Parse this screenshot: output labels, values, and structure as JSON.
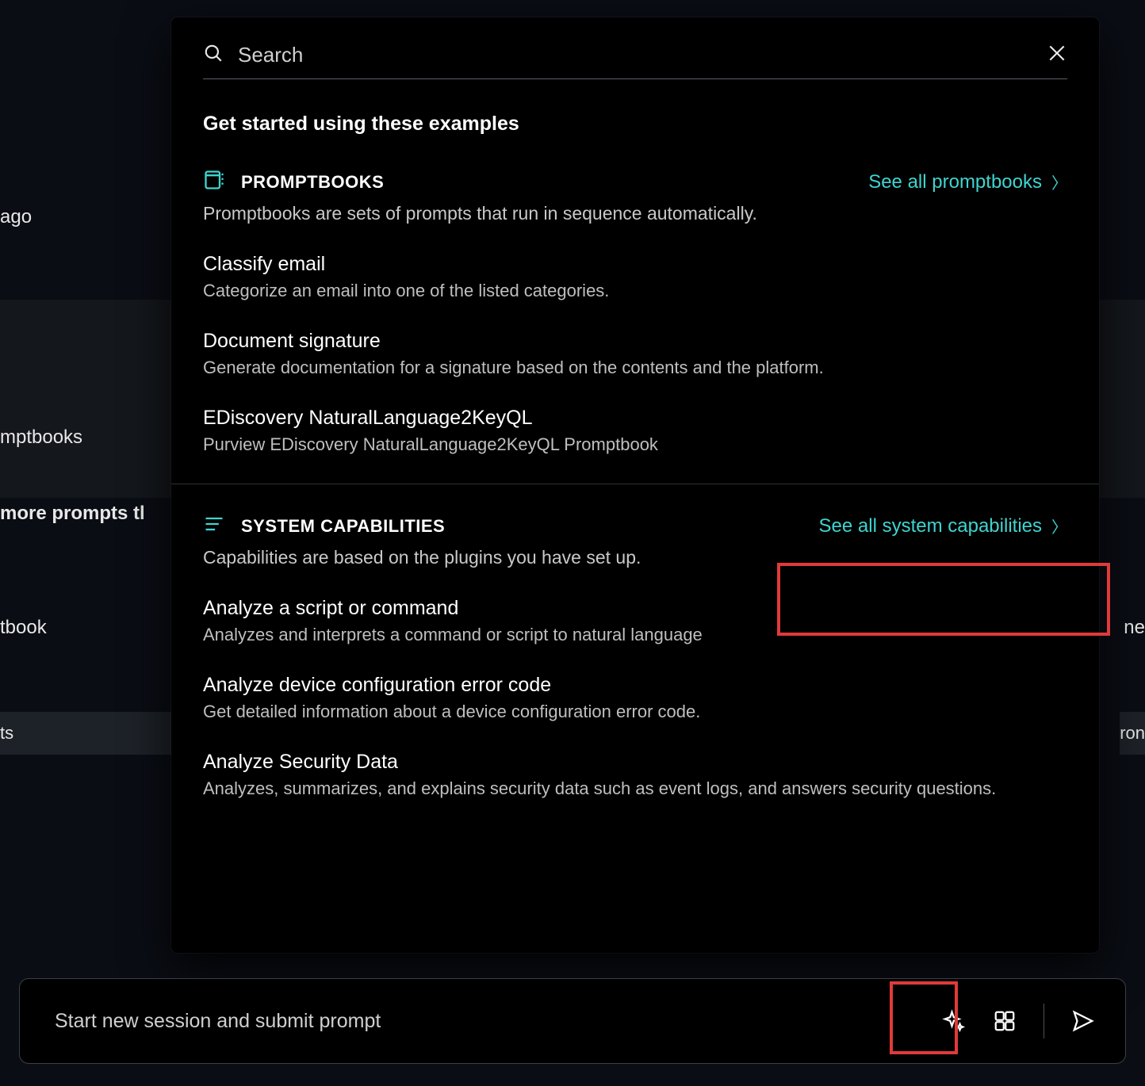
{
  "colors": {
    "accent": "#3fd4cf",
    "highlight": "#e03a3a"
  },
  "background": {
    "ago": "ago",
    "mptbooks": "mptbooks",
    "more_prompts": "more prompts tl",
    "tbook": "tbook",
    "ts": "ts",
    "ne": "ne",
    "ron": "ron"
  },
  "search": {
    "placeholder": "Search"
  },
  "subtitle": "Get started using these examples",
  "promptbooks": {
    "title": "PROMPTBOOKS",
    "see_all": "See all promptbooks",
    "desc": "Promptbooks are sets of prompts that run in sequence automatically.",
    "items": [
      {
        "title": "Classify email",
        "desc": "Categorize an email into one of the listed categories."
      },
      {
        "title": "Document signature",
        "desc": "Generate documentation for a signature based on the contents and the platform."
      },
      {
        "title": "EDiscovery NaturalLanguage2KeyQL",
        "desc": "Purview EDiscovery NaturalLanguage2KeyQL Promptbook"
      }
    ]
  },
  "capabilities": {
    "title": "SYSTEM CAPABILITIES",
    "see_all": "See all system capabilities",
    "desc": "Capabilities are based on the plugins you have set up.",
    "items": [
      {
        "title": "Analyze a script or command",
        "desc": "Analyzes and interprets a command or script to natural language"
      },
      {
        "title": "Analyze device configuration error code",
        "desc": "Get detailed information about a device configuration error code."
      },
      {
        "title": "Analyze Security Data",
        "desc": "Analyzes, summarizes, and explains security data such as event logs, and answers security questions."
      }
    ]
  },
  "prompt_bar": {
    "placeholder": "Start new session and submit prompt"
  }
}
